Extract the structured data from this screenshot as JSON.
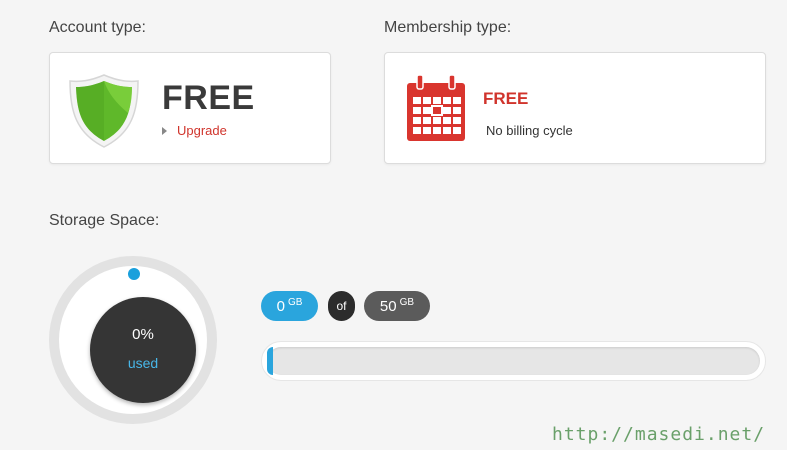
{
  "account": {
    "label": "Account type:",
    "type": "FREE",
    "upgrade_label": "Upgrade",
    "icon": "shield-icon"
  },
  "membership": {
    "label": "Membership type:",
    "type": "FREE",
    "billing": "No billing cycle",
    "icon": "calendar-icon"
  },
  "storage": {
    "label": "Storage Space:",
    "percent_label": "0%",
    "used_label": "used",
    "used_value": "0",
    "used_unit": "GB",
    "of_label": "of",
    "total_value": "50",
    "total_unit": "GB",
    "progress_fraction": 0
  },
  "watermark": "http://masedi.net/",
  "colors": {
    "accent_blue": "#2aa5dd",
    "accent_red": "#d0342c",
    "shield_green": "#5fb82a",
    "dark": "#353535"
  }
}
